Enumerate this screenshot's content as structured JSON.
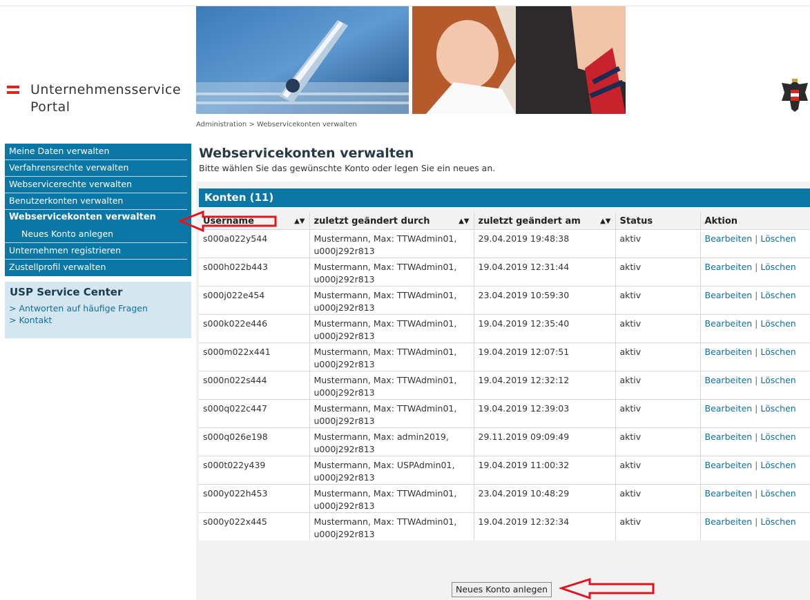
{
  "brand": {
    "line1": "Unternehmensservice",
    "line2": "Portal"
  },
  "breadcrumb": "Administration > Webservicekonten verwalten",
  "sidebar": {
    "items": [
      {
        "label": "Meine Daten verwalten"
      },
      {
        "label": "Verfahrensrechte verwalten"
      },
      {
        "label": "Webservicerechte verwalten"
      },
      {
        "label": "Benutzerkonten verwalten"
      },
      {
        "label": "Webservicekonten verwalten"
      },
      {
        "label": "Neues Konto anlegen"
      },
      {
        "label": "Unternehmen registrieren"
      },
      {
        "label": "Zustellprofil verwalten"
      }
    ]
  },
  "service_center": {
    "title": "USP Service Center",
    "links": [
      "> Antworten auf häufige Fragen",
      "> Kontakt"
    ]
  },
  "main": {
    "title": "Webservicekonten verwalten",
    "description": "Bitte wählen Sie das gewünschte Konto oder legen Sie ein neues an.",
    "section_title": "Konten (11)",
    "columns": [
      "Username",
      "zuletzt geändert durch",
      "zuletzt geändert am",
      "Status",
      "Aktion"
    ],
    "sort_symbol": "▲▼",
    "action_edit": "Bearbeiten",
    "action_sep": "|",
    "action_delete": "Löschen",
    "rows": [
      {
        "user": "s000a022y544",
        "by1": "Mustermann, Max: TTWAdmin01,",
        "by2": "u000j292r813",
        "date": "29.04.2019 19:48:38",
        "status": "aktiv"
      },
      {
        "user": "s000h022b443",
        "by1": "Mustermann, Max: TTWAdmin01,",
        "by2": "u000j292r813",
        "date": "19.04.2019 12:31:44",
        "status": "aktiv"
      },
      {
        "user": "s000j022e454",
        "by1": "Mustermann, Max: TTWAdmin01,",
        "by2": "u000j292r813",
        "date": "23.04.2019 10:59:30",
        "status": "aktiv"
      },
      {
        "user": "s000k022e446",
        "by1": "Mustermann, Max: TTWAdmin01,",
        "by2": "u000j292r813",
        "date": "19.04.2019 12:35:40",
        "status": "aktiv"
      },
      {
        "user": "s000m022x441",
        "by1": "Mustermann, Max: TTWAdmin01,",
        "by2": "u000j292r813",
        "date": "19.04.2019 12:07:51",
        "status": "aktiv"
      },
      {
        "user": "s000n022s444",
        "by1": "Mustermann, Max: TTWAdmin01,",
        "by2": "u000j292r813",
        "date": "19.04.2019 12:32:12",
        "status": "aktiv"
      },
      {
        "user": "s000q022c447",
        "by1": "Mustermann, Max: TTWAdmin01,",
        "by2": "u000j292r813",
        "date": "19.04.2019 12:39:03",
        "status": "aktiv"
      },
      {
        "user": "s000q026e198",
        "by1": "Mustermann, Max: admin2019,",
        "by2": "u000j292r813",
        "date": "29.11.2019 09:09:49",
        "status": "aktiv"
      },
      {
        "user": "s000t022y439",
        "by1": "Mustermann, Max: USPAdmin01,",
        "by2": "u000j292r813",
        "date": "19.04.2019 11:00:32",
        "status": "aktiv"
      },
      {
        "user": "s000y022h453",
        "by1": "Mustermann, Max: TTWAdmin01,",
        "by2": "u000j292r813",
        "date": "23.04.2019 10:48:29",
        "status": "aktiv"
      },
      {
        "user": "s000y022x445",
        "by1": "Mustermann, Max: TTWAdmin01,",
        "by2": "u000j292r813",
        "date": "19.04.2019 12:32:34",
        "status": "aktiv"
      }
    ],
    "new_button": "Neues Konto anlegen"
  },
  "colors": {
    "brand_blue": "#0b77a6",
    "link": "#0d6fa1",
    "annotation_red": "#e0141e",
    "flag_red": "#d52b1e"
  }
}
